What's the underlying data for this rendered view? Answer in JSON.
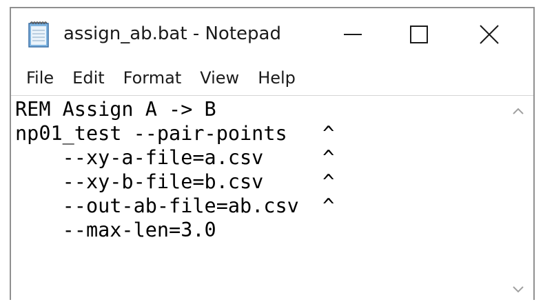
{
  "window": {
    "title": "assign_ab.bat - Notepad",
    "app_icon": "notepad-icon"
  },
  "caption_buttons": {
    "minimize_icon": "minimize-icon",
    "maximize_icon": "maximize-icon",
    "close_icon": "close-icon"
  },
  "menu": {
    "items": [
      "File",
      "Edit",
      "Format",
      "View",
      "Help"
    ]
  },
  "editor": {
    "content": "REM Assign A -> B\nnp01_test --pair-points   ^\n    --xy-a-file=a.csv     ^\n    --xy-b-file=b.csv     ^\n    --out-ab-file=ab.csv  ^\n    --max-len=3.0"
  },
  "scrollbar": {
    "up_icon": "chevron-up-icon",
    "down_icon": "chevron-down-icon"
  },
  "colors": {
    "border": "#8f8f8f",
    "text": "#000000",
    "scroll_arrow": "#a0a0a0"
  }
}
